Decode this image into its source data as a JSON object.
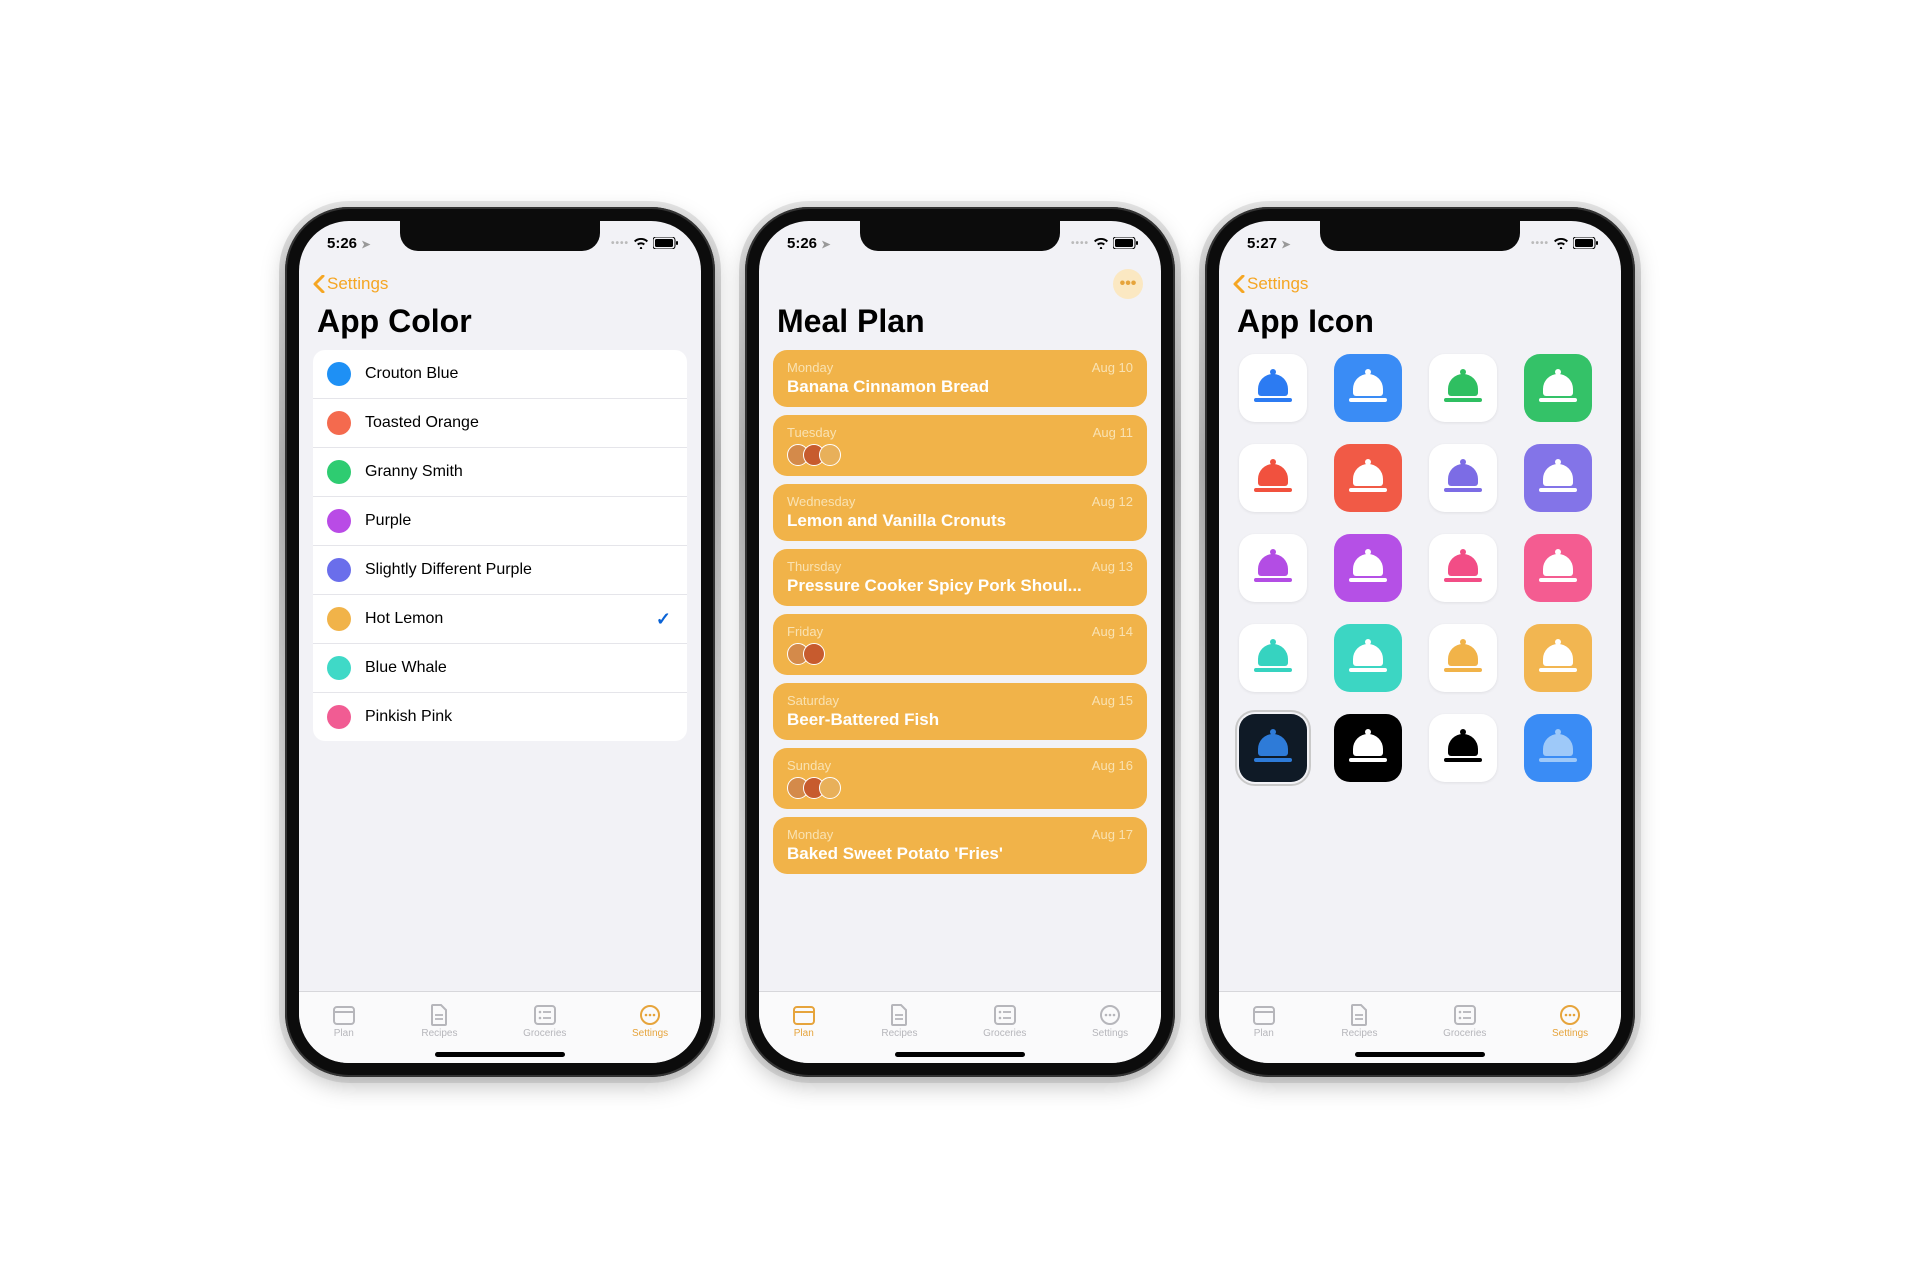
{
  "phones": {
    "color": {
      "time": "5:26",
      "back_label": "Settings",
      "title": "App Color",
      "colors": [
        {
          "name": "Crouton Blue",
          "hex": "#1E90F5",
          "selected": false
        },
        {
          "name": "Toasted Orange",
          "hex": "#F46A4E",
          "selected": false
        },
        {
          "name": "Granny Smith",
          "hex": "#2ECC71",
          "selected": false
        },
        {
          "name": "Purple",
          "hex": "#B94BE6",
          "selected": false
        },
        {
          "name": "Slightly Different Purple",
          "hex": "#6A6EEB",
          "selected": false
        },
        {
          "name": "Hot Lemon",
          "hex": "#F1B349",
          "selected": true
        },
        {
          "name": "Blue Whale",
          "hex": "#3FD9C7",
          "selected": false
        },
        {
          "name": "Pinkish Pink",
          "hex": "#F15C93",
          "selected": false
        }
      ]
    },
    "plan": {
      "time": "5:26",
      "title": "Meal Plan",
      "days": [
        {
          "day": "Monday",
          "date": "Aug 10",
          "meal": "Banana Cinnamon Bread",
          "images": 0
        },
        {
          "day": "Tuesday",
          "date": "Aug 11",
          "meal": "",
          "images": 3
        },
        {
          "day": "Wednesday",
          "date": "Aug 12",
          "meal": "Lemon and Vanilla Cronuts",
          "images": 0
        },
        {
          "day": "Thursday",
          "date": "Aug 13",
          "meal": "Pressure Cooker Spicy Pork Shoul...",
          "images": 0
        },
        {
          "day": "Friday",
          "date": "Aug 14",
          "meal": "",
          "images": 2
        },
        {
          "day": "Saturday",
          "date": "Aug 15",
          "meal": "Beer-Battered Fish",
          "images": 0
        },
        {
          "day": "Sunday",
          "date": "Aug 16",
          "meal": "",
          "images": 3
        },
        {
          "day": "Monday",
          "date": "Aug 17",
          "meal": "Baked Sweet Potato 'Fries'",
          "images": 0
        }
      ]
    },
    "icon": {
      "time": "5:27",
      "back_label": "Settings",
      "title": "App Icon",
      "icons": [
        {
          "bg": "#ffffff",
          "fg": "#2C7BF2",
          "selected": false
        },
        {
          "bg": "#3A8CF5",
          "fg": "#ffffff",
          "selected": false
        },
        {
          "bg": "#ffffff",
          "fg": "#2FBF61",
          "selected": false
        },
        {
          "bg": "#34C268",
          "fg": "#ffffff",
          "selected": false
        },
        {
          "bg": "#ffffff",
          "fg": "#F1513E",
          "selected": false
        },
        {
          "bg": "#F15A46",
          "fg": "#ffffff",
          "selected": false
        },
        {
          "bg": "#ffffff",
          "fg": "#7C6CE5",
          "selected": false
        },
        {
          "bg": "#8374E8",
          "fg": "#ffffff",
          "selected": false
        },
        {
          "bg": "#ffffff",
          "fg": "#B34DE4",
          "selected": false
        },
        {
          "bg": "#B550E6",
          "fg": "#ffffff",
          "selected": false
        },
        {
          "bg": "#ffffff",
          "fg": "#F24D86",
          "selected": false
        },
        {
          "bg": "#F45C91",
          "fg": "#ffffff",
          "selected": false
        },
        {
          "bg": "#ffffff",
          "fg": "#36D3C0",
          "selected": false
        },
        {
          "bg": "#3CD6C3",
          "fg": "#ffffff",
          "selected": false
        },
        {
          "bg": "#ffffff",
          "fg": "#F1B349",
          "selected": false
        },
        {
          "bg": "#F2B651",
          "fg": "#ffffff",
          "selected": false
        },
        {
          "bg": "#0F1A26",
          "fg": "#2E7BD8",
          "selected": true
        },
        {
          "bg": "#000000",
          "fg": "#ffffff",
          "selected": false
        },
        {
          "bg": "#ffffff",
          "fg": "#000000",
          "selected": false
        },
        {
          "bg": "#3A8CF5",
          "fg": "#9EC9F9",
          "selected": false
        }
      ]
    }
  },
  "tabs": [
    {
      "label": "Plan",
      "icon": "calendar"
    },
    {
      "label": "Recipes",
      "icon": "doc"
    },
    {
      "label": "Groceries",
      "icon": "list"
    },
    {
      "label": "Settings",
      "icon": "more"
    }
  ]
}
